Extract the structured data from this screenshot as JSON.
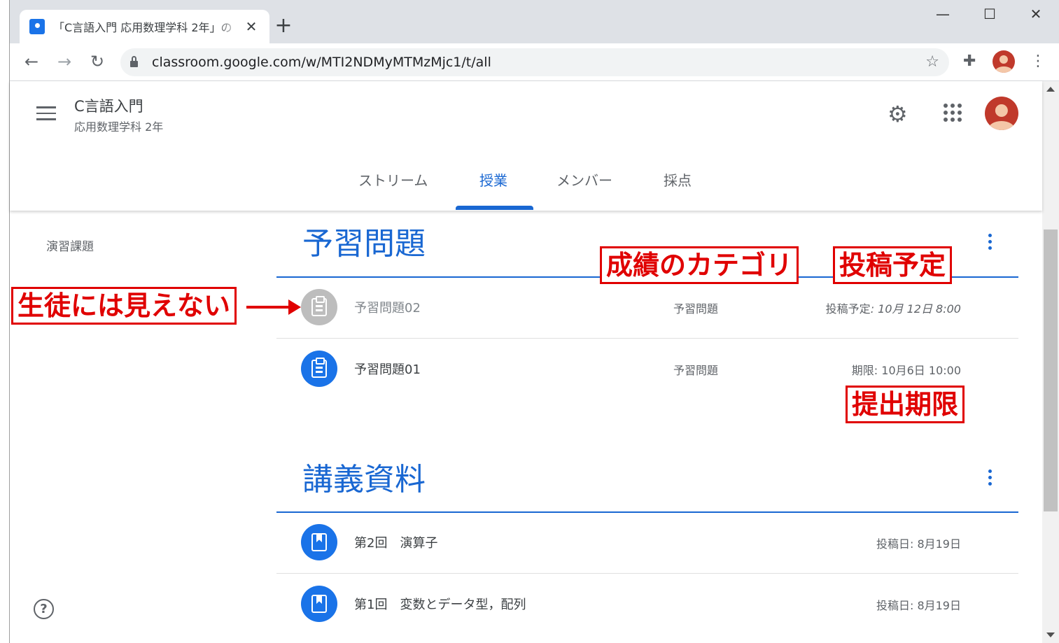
{
  "browser": {
    "tab_title": "「C言語入門 応用数理学科 2年」の",
    "tab_close": "✕",
    "new_tab": "+",
    "window_controls": {
      "minimize": "—",
      "maximize": "☐",
      "close": "✕"
    },
    "nav": {
      "back": "←",
      "forward": "→",
      "reload": "↻"
    },
    "url": "classroom.google.com/w/MTI2NDMyMTMzMjc1/t/all",
    "star": "☆",
    "extensions": "✚",
    "menu": "⋮"
  },
  "classroom": {
    "class_name": "C言語入門",
    "class_section": "応用数理学科 2年",
    "gear": "⚙",
    "tabs": [
      {
        "label": "ストリーム"
      },
      {
        "label": "授業"
      },
      {
        "label": "メンバー"
      },
      {
        "label": "採点"
      }
    ],
    "left_topics": [
      "演習課題"
    ],
    "help": "?",
    "topics": [
      {
        "title": "予習問題",
        "items": [
          {
            "title": "予習問題02",
            "category": "予習問題",
            "date_label": "投稿予定",
            "date_value": ": 10月 12日 8:00"
          },
          {
            "title": "予習問題01",
            "category": "予習問題",
            "date_text": "期限: 10月6日 10:00"
          }
        ]
      },
      {
        "title": "講義資料",
        "items": [
          {
            "title": "第2回　演算子",
            "date_text": "投稿日: 8月19日"
          },
          {
            "title": "第1回　変数とデータ型，配列",
            "date_text": "投稿日: 8月19日"
          }
        ]
      }
    ]
  },
  "annotations": {
    "invisible": "生徒には見えない",
    "grade_category": "成績のカテゴリ",
    "scheduled": "投稿予定",
    "deadline": "提出期限"
  },
  "colors": {
    "accent": "#1967d2",
    "annotation": "#e00000",
    "draft_icon": "#bdbdbd",
    "item_icon": "#1a73e8"
  }
}
